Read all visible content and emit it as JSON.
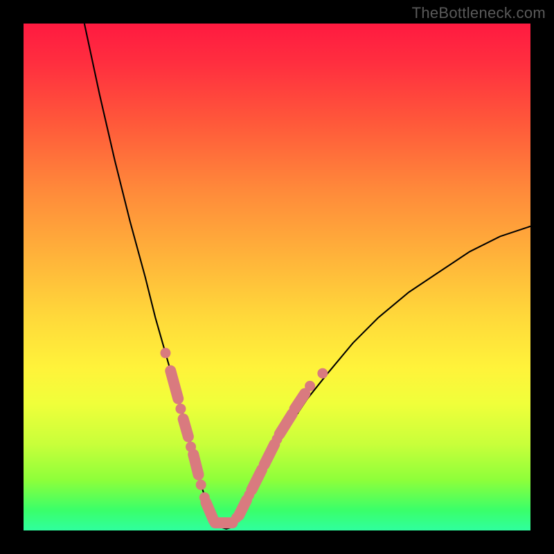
{
  "watermark": "TheBottleneck.com",
  "colors": {
    "frame": "#000000",
    "watermark": "#5a5a5a",
    "curve": "#000000",
    "marker": "#d97a7f",
    "gradient_top": "#ff1a40",
    "gradient_bottom": "#2fff9e"
  },
  "chart_data": {
    "type": "line",
    "title": "",
    "xlabel": "",
    "ylabel": "",
    "xlim": [
      0,
      100
    ],
    "ylim": [
      0,
      100
    ],
    "grid": false,
    "legend": null,
    "curve_note": "Asymmetric V-shaped curve. Approaches 100 at x≈12, minimum ~0 near x≈36–41, rises toward ~60 at x=100.",
    "x": [
      12,
      15,
      18,
      21,
      24,
      26,
      28,
      30,
      32,
      34,
      35,
      36,
      37,
      38,
      39,
      40,
      41,
      42,
      43,
      45,
      48,
      52,
      56,
      60,
      65,
      70,
      76,
      82,
      88,
      94,
      100
    ],
    "y": [
      100,
      86,
      73,
      61,
      50,
      42,
      35,
      28,
      21,
      13,
      9,
      6,
      3,
      1.5,
      0.6,
      0.3,
      0.6,
      1.5,
      3,
      7,
      13,
      20,
      26,
      31,
      37,
      42,
      47,
      51,
      55,
      58,
      60
    ],
    "markers_note": "Salmon-colored dots and elongated pill-shaped segments overlaid along the curve near the bottom of the V, roughly y < 30.",
    "markers": [
      {
        "kind": "dot",
        "x": 28.0,
        "y": 35.0
      },
      {
        "kind": "pill",
        "x1": 29.0,
        "y1": 31.5,
        "x2": 30.5,
        "y2": 26.0
      },
      {
        "kind": "dot",
        "x": 31.0,
        "y": 24.0
      },
      {
        "kind": "pill",
        "x1": 31.5,
        "y1": 22.0,
        "x2": 32.5,
        "y2": 18.5
      },
      {
        "kind": "dot",
        "x": 33.0,
        "y": 16.5
      },
      {
        "kind": "pill",
        "x1": 33.5,
        "y1": 15.0,
        "x2": 34.5,
        "y2": 11.0
      },
      {
        "kind": "dot",
        "x": 35.0,
        "y": 9.0
      },
      {
        "kind": "dot",
        "x": 35.7,
        "y": 6.5
      },
      {
        "kind": "pill",
        "x1": 36.0,
        "y1": 5.5,
        "x2": 37.5,
        "y2": 2.0
      },
      {
        "kind": "pill",
        "x1": 37.8,
        "y1": 1.5,
        "x2": 41.2,
        "y2": 1.5
      },
      {
        "kind": "dot",
        "x": 42.0,
        "y": 2.5
      },
      {
        "kind": "pill",
        "x1": 42.5,
        "y1": 3.0,
        "x2": 44.0,
        "y2": 6.0
      },
      {
        "kind": "dot",
        "x": 44.5,
        "y": 7.0
      },
      {
        "kind": "pill",
        "x1": 45.0,
        "y1": 8.0,
        "x2": 47.0,
        "y2": 12.0
      },
      {
        "kind": "pill",
        "x1": 47.5,
        "y1": 13.0,
        "x2": 49.5,
        "y2": 17.0
      },
      {
        "kind": "dot",
        "x": 50.0,
        "y": 18.0
      },
      {
        "kind": "pill",
        "x1": 50.5,
        "y1": 19.0,
        "x2": 53.0,
        "y2": 23.0
      },
      {
        "kind": "pill",
        "x1": 53.5,
        "y1": 24.0,
        "x2": 55.5,
        "y2": 27.0
      },
      {
        "kind": "dot",
        "x": 56.5,
        "y": 28.5
      },
      {
        "kind": "dot",
        "x": 59.0,
        "y": 31.0
      }
    ]
  }
}
